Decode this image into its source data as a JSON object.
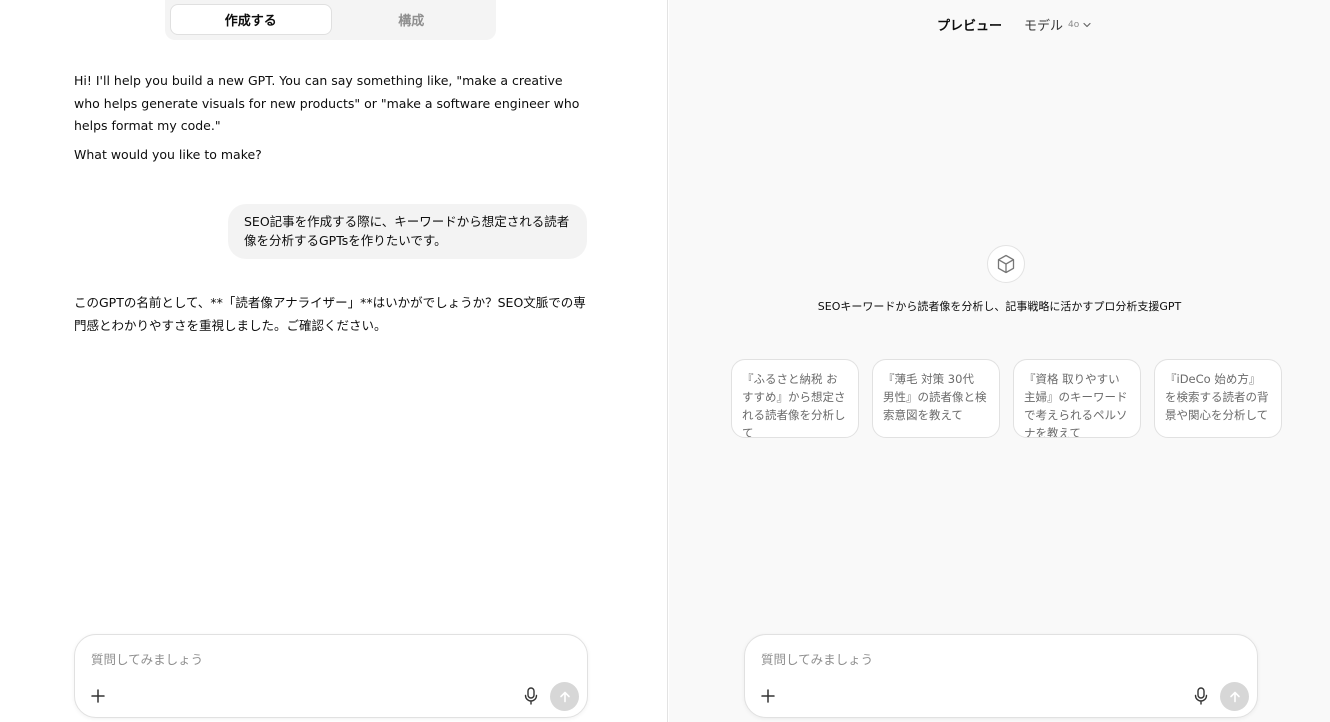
{
  "tabs": {
    "create": "作成する",
    "configure": "構成"
  },
  "chat": {
    "assistant_intro": "Hi! I'll help you build a new GPT. You can say something like, \"make a creative who helps generate visuals for new products\" or \"make a software engineer who helps format my code.\"",
    "assistant_question": "What would you like to make?",
    "user_message": "SEO記事を作成する際に、キーワードから想定される読者像を分析するGPTsを作りたいです。",
    "assistant_reply": "このGPTの名前として、**「読者像アナライザー」**はいかがでしょうか？SEO文脈での専門感とわかりやすさを重視しました。ご確認ください。"
  },
  "composer_left": {
    "placeholder": "質問してみましょう"
  },
  "preview": {
    "title": "プレビュー",
    "model_label": "モデル",
    "model_version": "4o",
    "gpt_description": "SEOキーワードから読者像を分析し、記事戦略に活かすプロ分析支援GPT",
    "starters": [
      "『ふるさと納税 おすすめ』から想定される読者像を分析して",
      "『薄毛 対策 30代 男性』の読者像と検索意図を教えて",
      "『資格 取りやすい 主婦』のキーワードで考えられるペルソナを教えて",
      "『iDeCo 始め方』を検索する読者の背景や関心を分析して"
    ]
  },
  "composer_right": {
    "placeholder": "質問してみましょう"
  },
  "icons": {
    "plus": "plus-icon",
    "mic": "microphone-icon",
    "send": "arrow-up-icon",
    "chevron": "chevron-down-icon",
    "gpt": "cube-icon"
  }
}
